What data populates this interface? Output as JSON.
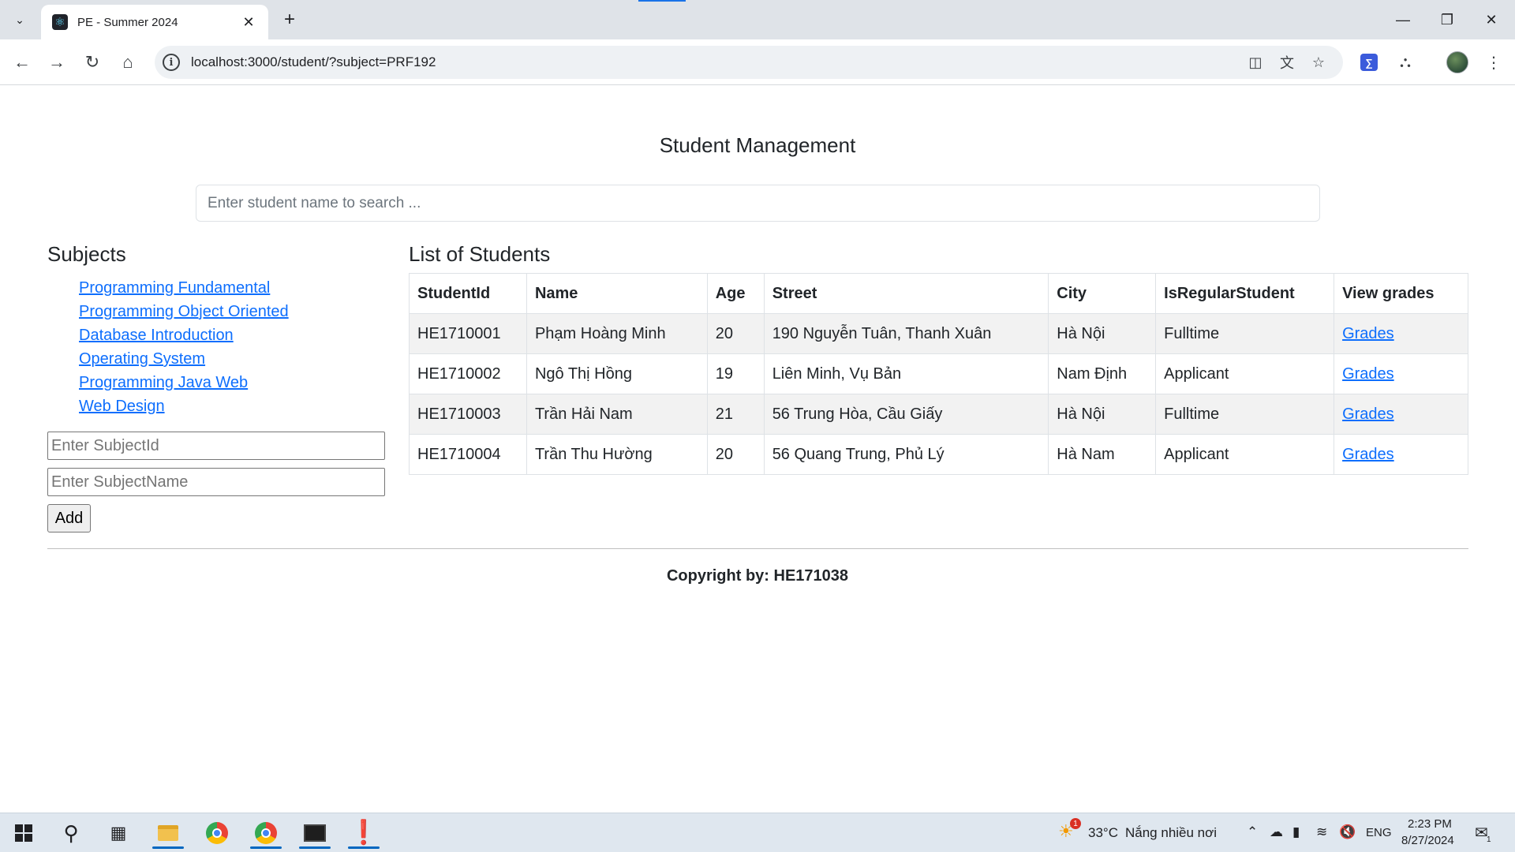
{
  "browser": {
    "tab_title": "PE - Summer 2024",
    "url": "localhost:3000/student/?subject=PRF192"
  },
  "page": {
    "title": "Student Management",
    "search_placeholder": "Enter student name to search ..."
  },
  "subjects": {
    "heading": "Subjects",
    "items": [
      "Programming Fundamental",
      "Programming Object Oriented",
      "Database Introduction",
      "Operating System",
      "Programming Java Web",
      "Web Design"
    ],
    "subject_id_placeholder": "Enter SubjectId",
    "subject_name_placeholder": "Enter SubjectName",
    "add_label": "Add"
  },
  "students": {
    "heading": "List of Students",
    "columns": [
      "StudentId",
      "Name",
      "Age",
      "Street",
      "City",
      "IsRegularStudent",
      "View grades"
    ],
    "rows": [
      {
        "id": "HE1710001",
        "name": "Phạm Hoàng Minh",
        "age": "20",
        "street": "190 Nguyễn Tuân, Thanh Xuân",
        "city": "Hà Nội",
        "type": "Fulltime",
        "link": "Grades"
      },
      {
        "id": "HE1710002",
        "name": "Ngô Thị Hồng",
        "age": "19",
        "street": "Liên Minh, Vụ Bản",
        "city": "Nam Định",
        "type": "Applicant",
        "link": "Grades"
      },
      {
        "id": "HE1710003",
        "name": "Trần Hải Nam",
        "age": "21",
        "street": "56 Trung Hòa, Cầu Giấy",
        "city": "Hà Nội",
        "type": "Fulltime",
        "link": "Grades"
      },
      {
        "id": "HE1710004",
        "name": "Trần Thu Hường",
        "age": "20",
        "street": "56 Quang Trung, Phủ Lý",
        "city": "Hà Nam",
        "type": "Applicant",
        "link": "Grades"
      }
    ]
  },
  "footer": {
    "text": "Copyright by: HE171038"
  },
  "taskbar": {
    "weather_temp": "33°C",
    "weather_text": "Nắng nhiều nơi",
    "weather_badge": "1",
    "language": "ENG",
    "time": "2:23 PM",
    "date": "8/27/2024",
    "notification_count": "1"
  },
  "colors": {
    "link": "#0d6efd",
    "stripe": "#f2f2f2",
    "taskbar_bg": "#dfe7ef",
    "tabbar_bg": "#dfe3e8"
  }
}
